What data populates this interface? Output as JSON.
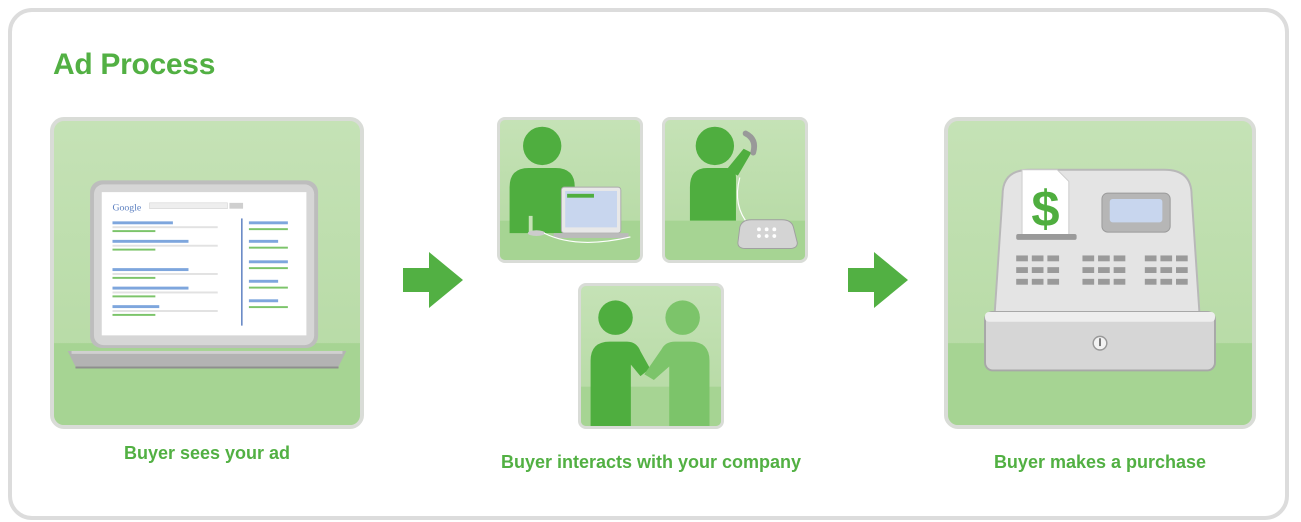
{
  "title": "Ad Process",
  "steps": [
    {
      "caption": "Buyer sees your ad"
    },
    {
      "caption": "Buyer interacts with your company"
    },
    {
      "caption": "Buyer makes a purchase"
    }
  ],
  "screen_brand": "Google",
  "register_symbol": "$",
  "colors": {
    "accent_green": "#52b043",
    "tile_bg": "#c5e2b6",
    "tile_floor": "#9fd088",
    "person_dark": "#4fae3f",
    "person_light": "#7cc46a",
    "border_gray": "#dcdcdc"
  },
  "icons": [
    "laptop-icon",
    "person-at-laptop-icon",
    "person-on-phone-icon",
    "handshake-icon",
    "cash-register-icon",
    "arrow-right-icon"
  ]
}
